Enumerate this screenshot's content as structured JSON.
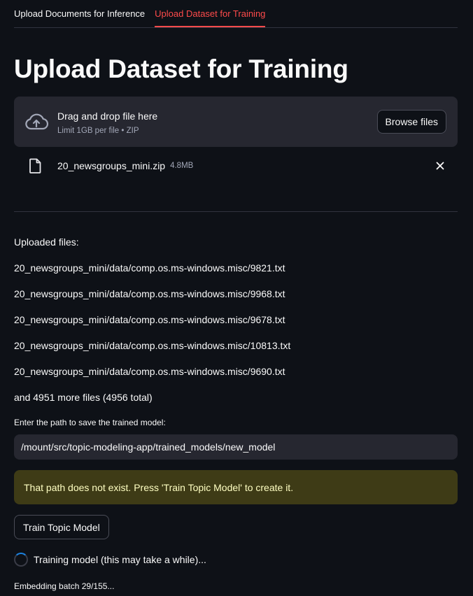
{
  "tabs": [
    {
      "label": "Upload Documents for Inference",
      "active": false
    },
    {
      "label": "Upload Dataset for Training",
      "active": true
    }
  ],
  "page_title": "Upload Dataset for Training",
  "uploader": {
    "drag_text": "Drag and drop file here",
    "limit_text": "Limit 1GB per file • ZIP",
    "browse_label": "Browse files",
    "icon": "cloud-upload-icon"
  },
  "uploaded_file": {
    "name": "20_newsgroups_mini.zip",
    "size": "4.8MB",
    "icon": "file-icon"
  },
  "uploaded_files_label": "Uploaded files:",
  "file_list": [
    "20_newsgroups_mini/data/comp.os.ms-windows.misc/9821.txt",
    "20_newsgroups_mini/data/comp.os.ms-windows.misc/9968.txt",
    "20_newsgroups_mini/data/comp.os.ms-windows.misc/9678.txt",
    "20_newsgroups_mini/data/comp.os.ms-windows.misc/10813.txt",
    "20_newsgroups_mini/data/comp.os.ms-windows.misc/9690.txt"
  ],
  "more_files_text": "and 4951 more files (4956 total)",
  "path_label": "Enter the path to save the trained model:",
  "path_value": "/mount/src/topic-modeling-app/trained_models/new_model",
  "warning_text": "That path does not exist. Press 'Train Topic Model' to create it.",
  "train_button_label": "Train Topic Model",
  "spinner_text": "Training model (this may take a while)...",
  "progress": {
    "label": "Embedding batch 29/155...",
    "fraction": 0.187
  },
  "colors": {
    "background": "#0e1117",
    "accent": "#ff4b4b",
    "progress": "#1c83e1",
    "warning_bg": "#3e3b16",
    "warning_text": "#ffffc2"
  }
}
